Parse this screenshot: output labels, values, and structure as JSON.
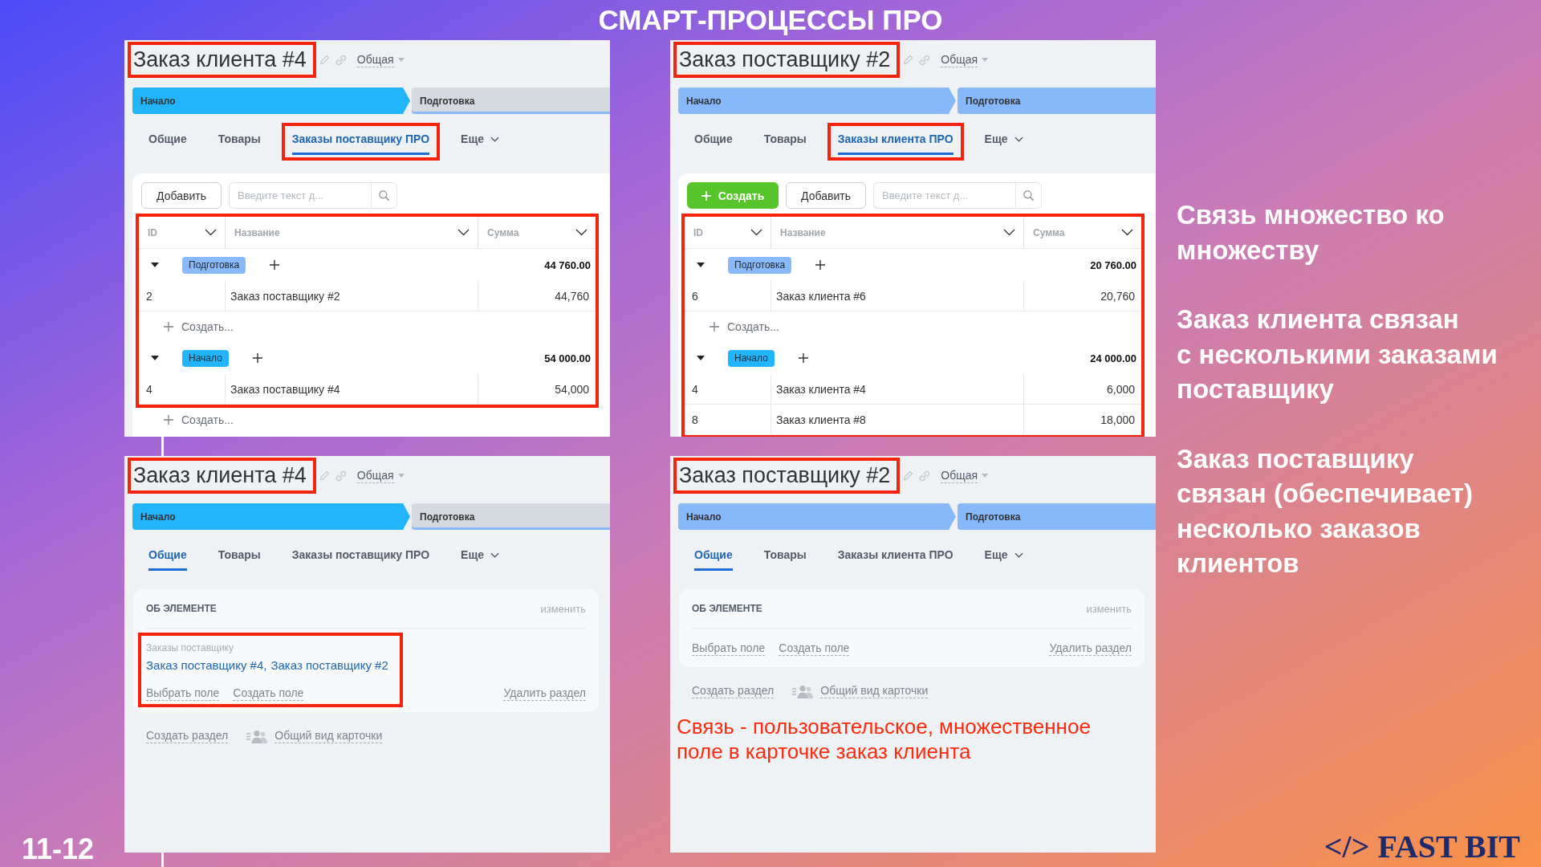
{
  "slide": {
    "title": "СМАРТ-ПРОЦЕССЫ ПРО",
    "page_number": "11-12",
    "logo": "</> FAST BIT"
  },
  "panels": [
    {
      "kind": "list",
      "title": "Заказ клиента #4",
      "title_highlighted": true,
      "category": "Общая",
      "stages": [
        {
          "label": "Начало",
          "color": "#22b5fb",
          "reached": true
        },
        {
          "label": "Подготовка",
          "color": "#8ab9fb",
          "reached": false
        }
      ],
      "tabs": [
        {
          "kind": "tab",
          "label": "Общие",
          "selected": false,
          "highlighted": false
        },
        {
          "kind": "tab",
          "label": "Товары",
          "selected": false,
          "highlighted": false
        },
        {
          "kind": "tab",
          "label": "Заказы поставщику ПРО",
          "selected": true,
          "highlighted": true
        },
        {
          "kind": "menu",
          "label": "Еще",
          "selected": false,
          "highlighted": false
        }
      ],
      "toolbar": {
        "buttons": [
          {
            "kind": "secondary",
            "label": "Добавить"
          }
        ],
        "search": {
          "placeholder": "Введите текст д..."
        }
      },
      "table": {
        "highlighted": true,
        "columns": [
          "ID",
          "Название",
          "Сумма"
        ],
        "groups": [
          {
            "label": "Подготовка",
            "color": "#8ab9fb",
            "expanded": true,
            "total": "44 760.00",
            "rows": [
              {
                "id": "2",
                "name": "Заказ поставщику #2",
                "sum": "44,760"
              }
            ],
            "create_label": "Создать..."
          },
          {
            "label": "Начало",
            "color": "#22b5fb",
            "expanded": true,
            "total": "54 000.00",
            "rows": [
              {
                "id": "4",
                "name": "Заказ поставщику #4",
                "sum": "54,000"
              }
            ],
            "create_label": "Создать..."
          }
        ]
      }
    },
    {
      "kind": "list",
      "title": "Заказ поставщику #2",
      "title_highlighted": true,
      "category": "Общая",
      "stages": [
        {
          "label": "Начало",
          "color": "#87b8fb",
          "reached": true
        },
        {
          "label": "Подготовка",
          "color": "#87b8fb",
          "reached": true
        }
      ],
      "tabs": [
        {
          "kind": "tab",
          "label": "Общие",
          "selected": false,
          "highlighted": false
        },
        {
          "kind": "tab",
          "label": "Товары",
          "selected": false,
          "highlighted": false
        },
        {
          "kind": "tab",
          "label": "Заказы клиента ПРО",
          "selected": true,
          "highlighted": true
        },
        {
          "kind": "menu",
          "label": "Еще",
          "selected": false,
          "highlighted": false
        }
      ],
      "toolbar": {
        "buttons": [
          {
            "kind": "primary",
            "label": "Создать"
          },
          {
            "kind": "secondary",
            "label": "Добавить"
          }
        ],
        "search": {
          "placeholder": "Введите текст д..."
        }
      },
      "table": {
        "highlighted": true,
        "columns": [
          "ID",
          "Название",
          "Сумма"
        ],
        "groups": [
          {
            "label": "Подготовка",
            "color": "#8ab9fb",
            "expanded": true,
            "total": "20 760.00",
            "rows": [
              {
                "id": "6",
                "name": "Заказ клиента #6",
                "sum": "20,760"
              }
            ],
            "create_label": "Создать..."
          },
          {
            "label": "Начало",
            "color": "#22b5fb",
            "expanded": true,
            "total": "24 000.00",
            "rows": [
              {
                "id": "4",
                "name": "Заказ клиента #4",
                "sum": "6,000"
              },
              {
                "id": "8",
                "name": "Заказ клиента #8",
                "sum": "18,000"
              }
            ]
          }
        ]
      }
    },
    {
      "kind": "details",
      "title": "Заказ клиента #4",
      "title_highlighted": true,
      "category": "Общая",
      "stages": [
        {
          "label": "Начало",
          "color": "#22b5fb",
          "reached": true
        },
        {
          "label": "Подготовка",
          "color": "#8ab9fb",
          "reached": false
        }
      ],
      "tabs": [
        {
          "kind": "tab",
          "label": "Общие",
          "selected": true,
          "highlighted": false
        },
        {
          "kind": "tab",
          "label": "Товары",
          "selected": false,
          "highlighted": false
        },
        {
          "kind": "tab",
          "label": "Заказы поставщику ПРО",
          "selected": false,
          "highlighted": false
        },
        {
          "kind": "menu",
          "label": "Еще",
          "selected": false,
          "highlighted": false
        }
      ],
      "section": {
        "title": "ОБ ЭЛЕМЕНТЕ",
        "edit_label": "изменить",
        "highlighted": true,
        "fields": [
          {
            "label": "Заказы поставщику",
            "values": [
              "Заказ поставщику #4",
              "Заказ поставщику #2"
            ],
            "separator": ","
          }
        ],
        "actions": [
          "Выбрать поле",
          "Создать поле"
        ],
        "delete_label": "Удалить раздел"
      },
      "footer_links": {
        "create_section": "Создать раздел",
        "card_view": "Общий вид карточки"
      }
    },
    {
      "kind": "details",
      "title": "Заказ поставщику #2",
      "title_highlighted": true,
      "category": "Общая",
      "stages": [
        {
          "label": "Начало",
          "color": "#87b8fb",
          "reached": true
        },
        {
          "label": "Подготовка",
          "color": "#87b8fb",
          "reached": true
        }
      ],
      "tabs": [
        {
          "kind": "tab",
          "label": "Общие",
          "selected": true,
          "highlighted": false
        },
        {
          "kind": "tab",
          "label": "Товары",
          "selected": false,
          "highlighted": false
        },
        {
          "kind": "tab",
          "label": "Заказы клиента ПРО",
          "selected": false,
          "highlighted": false
        },
        {
          "kind": "menu",
          "label": "Еще",
          "selected": false,
          "highlighted": false
        }
      ],
      "section": {
        "title": "ОБ ЭЛЕМЕНТЕ",
        "edit_label": "изменить",
        "actions": [
          "Выбрать поле",
          "Создать поле"
        ],
        "delete_label": "Удалить раздел"
      },
      "footer_links": {
        "create_section": "Создать раздел",
        "card_view": "Общий вид карточки"
      },
      "note": "Связь - пользовательское, множественное поле в карточке заказ клиента"
    }
  ],
  "notes": [
    "Связь множество ко\nмножеству",
    "Заказ клиента связан\nс несколькими заказами\nпоставщику",
    "Заказ поставщику\nсвязан (обеспечивает)\nнесколько заказов\nклиентов"
  ]
}
